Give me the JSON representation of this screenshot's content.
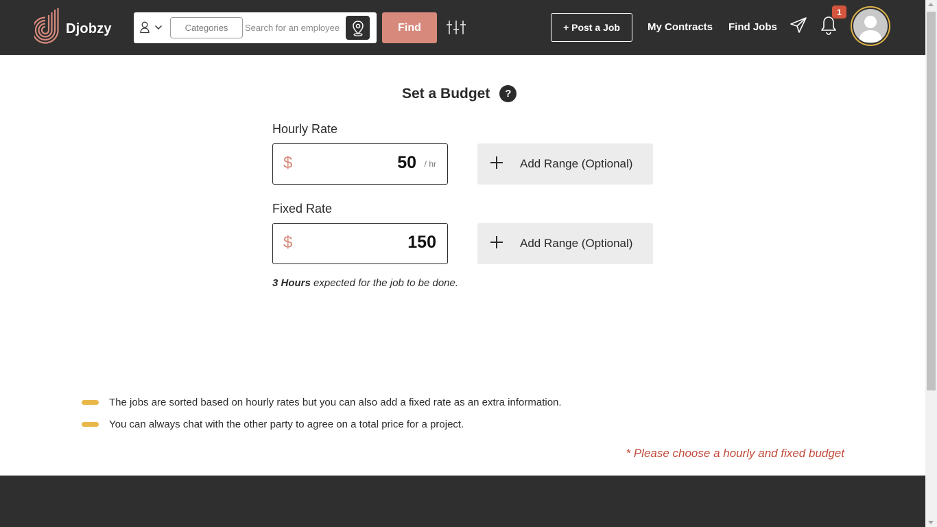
{
  "header": {
    "logo_text": "Djobzy",
    "search": {
      "categories_label": "Categories",
      "placeholder": "Search for an employee"
    },
    "find_label": "Find",
    "post_job_label": "+ Post a Job",
    "nav": {
      "my_contracts": "My Contracts",
      "find_jobs": "Find Jobs"
    },
    "notification_count": "1"
  },
  "budget": {
    "title": "Set a Budget",
    "help": "?",
    "hourly": {
      "label": "Hourly Rate",
      "currency": "$",
      "value": "50",
      "unit": "/ hr",
      "range_label": "Add Range (Optional)"
    },
    "fixed": {
      "label": "Fixed Rate",
      "currency": "$",
      "value": "150",
      "range_label": "Add Range (Optional)"
    },
    "hours_bold": "3 Hours",
    "hours_text": " expected for the job to be done."
  },
  "info": [
    "The jobs are sorted based on hourly rates but you can also add a fixed rate as an extra information.",
    "You can always chat with the other party to agree on a total price for a project."
  ],
  "warning": "* Please choose a hourly and fixed budget",
  "colors": {
    "header_bg": "#2f2f2f",
    "accent": "#d78a7c",
    "bullet": "#e8b84a",
    "warning": "#c14a3a",
    "badge": "#d4553d"
  },
  "icons": [
    "logo-icon",
    "user-icon",
    "chevron-down-icon",
    "location-pin-icon",
    "filter-sliders-icon",
    "send-icon",
    "bell-icon",
    "avatar-icon",
    "help-icon",
    "plus-icon"
  ]
}
